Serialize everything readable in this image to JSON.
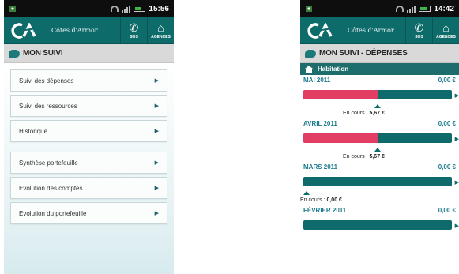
{
  "left": {
    "status": {
      "time": "15:56"
    },
    "appbar": {
      "region": "Côtes d'Armor",
      "sos": "SOS",
      "agences": "AGENCES"
    },
    "section_title": "MON SUIVI",
    "menu_group1": [
      {
        "label": "Suivi des dépenses"
      },
      {
        "label": "Suivi des ressources"
      },
      {
        "label": "Historique"
      }
    ],
    "menu_group2": [
      {
        "label": "Synthèse portefeuille"
      },
      {
        "label": "Evolution des comptes"
      },
      {
        "label": "Evolution du portefeuille"
      }
    ]
  },
  "right": {
    "status": {
      "time": "14:42"
    },
    "appbar": {
      "region": "Côtes d'Armor",
      "sos": "SOS",
      "agences": "AGENCES"
    },
    "section_title": "MON SUIVI - DÉPENSES",
    "category": "Habitation",
    "encours_prefix": "En cours : ",
    "months": [
      {
        "name": "MAI 2011",
        "value": "0,00 €",
        "progress": 0.5,
        "encours": "5,67 €"
      },
      {
        "name": "AVRIL 2011",
        "value": "0,00 €",
        "progress": 0.5,
        "encours": "5,67 €"
      },
      {
        "name": "MARS 2011",
        "value": "0,00 €",
        "progress": 0.0,
        "encours": "0,00 €"
      },
      {
        "name": "FÉVRIER 2011",
        "value": "0,00 €",
        "progress": 0.0,
        "encours": ""
      }
    ]
  },
  "colors": {
    "teal": "#0d6b6a",
    "accent_pink": "#e23d62",
    "month_blue": "#1b7a8e"
  },
  "icons": [
    "ca-logo-icon",
    "sos-phone-icon",
    "agences-house-icon",
    "chat-bubble-icon",
    "home-icon",
    "play-arrow-icon",
    "wifi-icon",
    "signal-icon",
    "battery-icon",
    "notification-icon"
  ]
}
